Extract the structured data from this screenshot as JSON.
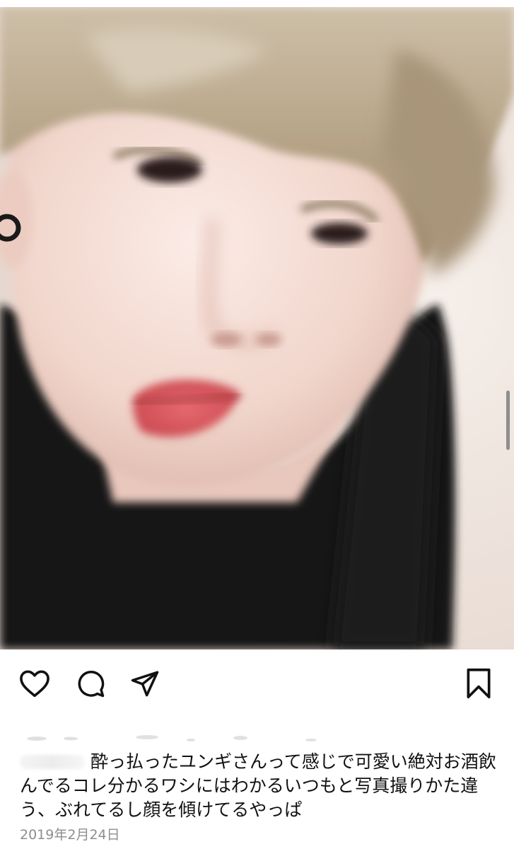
{
  "post": {
    "caption_text": "酔っ払ったユンギさんって感じで可愛い絶対お酒飲んでるコレ分かるワシにはわかるいつもと写真撮りかた違う、ぶれてるし顔を傾けてるやっぱ",
    "date": "2019年2月24日"
  },
  "icons": {
    "like": "heart-icon",
    "comment": "comment-icon",
    "share": "send-icon",
    "save": "bookmark-icon"
  },
  "colors": {
    "icon": "#111111",
    "date": "#8e8e8e",
    "hair": "#b8a68b",
    "shirt": "#141414",
    "skin": "#f4dcd4"
  }
}
